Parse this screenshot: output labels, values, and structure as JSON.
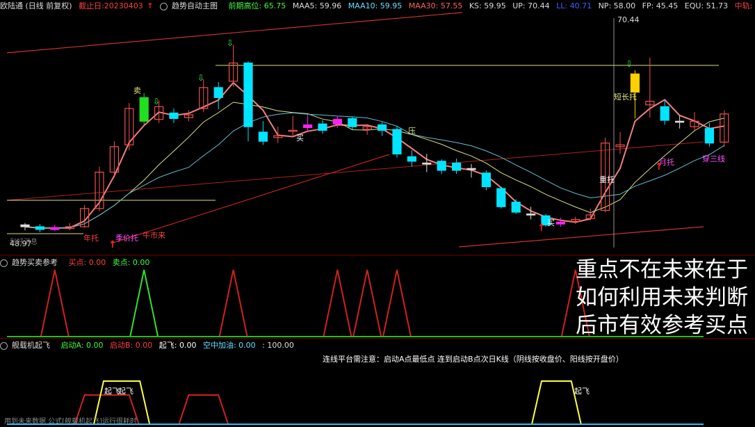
{
  "header_main": {
    "stock": "欧陆通 (日线 前复权)",
    "cutoff_label": "截止日:20230403",
    "arrow": "↑",
    "indicator": "趋势自动主图",
    "prev_high": "前期高位: 65.75",
    "maa5": "MAA5: 59.96",
    "maa10": "MAA10: 59.95",
    "maa30": "MAA30: 57.55",
    "ks": "KS: 59.95",
    "up": "UP: 70.44",
    "ll": "LL: 40.71",
    "np": "NP: 58.00",
    "fp": "FP: 45.45",
    "equ": "EQU: 51.73",
    "mid": "中轨: 58.",
    "diamond": "◇"
  },
  "header_sub1": {
    "name": "趋势买卖参考",
    "buy": "买点: 0.00",
    "sell": "卖点: 0.00"
  },
  "header_sub2": {
    "name": "舰载机起飞",
    "a": "启动A: 0.00",
    "b": "启动B: 0.00",
    "takeoff": "起飞: 0.00",
    "refuel": "空中加油: 0.00",
    "hundred": ": 100.00"
  },
  "note_line": "连线平台需注意：启动A点最低点 连到启动B点次日K线（阴线按收盘价、阳线按开盘价）",
  "overlay": [
    "重点不在未来在于",
    "如何利用未来判断",
    "后市有效参考买点"
  ],
  "footer_text": "用到未来数据 公式[舰载机起飞]运行很耗时",
  "colors": {
    "up": "#f05050",
    "down": "#00e5ff",
    "ma_pink": "#f08080",
    "ma_yellow": "#e0e080",
    "ma_cyan": "#60c0d0",
    "trend_red": "#c02020"
  },
  "chart_data": [
    {
      "type": "candlestick",
      "title": "趋势自动主图",
      "ylim": [
        45,
        71
      ],
      "annotations": {
        "high_label": "70.44",
        "low_label": "48.97",
        "labels": [
          "卖",
          "买",
          "压",
          "买",
          "重托",
          "短长托",
          "月托",
          "穿三线",
          "年托",
          "季价托",
          "牛市来",
          "利好消息"
        ]
      },
      "candles": [
        {
          "o": 47.8,
          "c": 47.6,
          "h": 48.0,
          "l": 47.2,
          "t": "flat"
        },
        {
          "o": 47.6,
          "c": 47.3,
          "h": 47.9,
          "l": 47.0,
          "t": "down"
        },
        {
          "o": 47.3,
          "c": 47.5,
          "h": 47.8,
          "l": 47.1,
          "t": "magenta"
        },
        {
          "o": 47.4,
          "c": 47.6,
          "h": 48.0,
          "l": 47.2,
          "t": "up"
        },
        {
          "o": 47.6,
          "c": 49.6,
          "h": 50.0,
          "l": 47.5,
          "t": "up"
        },
        {
          "o": 49.6,
          "c": 53.6,
          "h": 54.2,
          "l": 49.3,
          "t": "up"
        },
        {
          "o": 53.6,
          "c": 56.4,
          "h": 57.0,
          "l": 53.2,
          "t": "up"
        },
        {
          "o": 56.6,
          "c": 60.6,
          "h": 61.2,
          "l": 56.0,
          "t": "up"
        },
        {
          "o": 61.8,
          "c": 59.2,
          "h": 62.3,
          "l": 58.8,
          "t": "green"
        },
        {
          "o": 59.4,
          "c": 60.8,
          "h": 61.5,
          "l": 59.0,
          "t": "up"
        },
        {
          "o": 60.1,
          "c": 59.5,
          "h": 60.6,
          "l": 59.0,
          "t": "down"
        },
        {
          "o": 59.6,
          "c": 59.9,
          "h": 60.4,
          "l": 59.2,
          "t": "up"
        },
        {
          "o": 60.6,
          "c": 62.9,
          "h": 63.8,
          "l": 60.2,
          "t": "up"
        },
        {
          "o": 62.9,
          "c": 61.8,
          "h": 63.5,
          "l": 60.5,
          "t": "down"
        },
        {
          "o": 63.6,
          "c": 65.6,
          "h": 67.6,
          "l": 63.0,
          "t": "up"
        },
        {
          "o": 65.6,
          "c": 58.6,
          "h": 65.8,
          "l": 57.0,
          "t": "down"
        },
        {
          "o": 58.0,
          "c": 57.0,
          "h": 59.2,
          "l": 56.6,
          "t": "down"
        },
        {
          "o": 57.6,
          "c": 57.4,
          "h": 58.6,
          "l": 56.8,
          "t": "up"
        },
        {
          "o": 58.2,
          "c": 58.1,
          "h": 59.8,
          "l": 57.6,
          "t": "up"
        },
        {
          "o": 58.5,
          "c": 58.8,
          "h": 59.9,
          "l": 58.0,
          "t": "magenta"
        },
        {
          "o": 58.9,
          "c": 58.2,
          "h": 59.3,
          "l": 57.8,
          "t": "down"
        },
        {
          "o": 58.9,
          "c": 59.4,
          "h": 59.8,
          "l": 58.5,
          "t": "magenta"
        },
        {
          "o": 59.5,
          "c": 58.6,
          "h": 59.7,
          "l": 58.3,
          "t": "down"
        },
        {
          "o": 58.6,
          "c": 58.3,
          "h": 58.9,
          "l": 57.7,
          "t": "up"
        },
        {
          "o": 58.8,
          "c": 58.2,
          "h": 59.1,
          "l": 57.6,
          "t": "down"
        },
        {
          "o": 58.3,
          "c": 55.6,
          "h": 58.6,
          "l": 55.2,
          "t": "down"
        },
        {
          "o": 55.3,
          "c": 54.8,
          "h": 56.0,
          "l": 54.2,
          "t": "down"
        },
        {
          "o": 54.6,
          "c": 54.6,
          "h": 55.6,
          "l": 53.6,
          "t": "flat"
        },
        {
          "o": 54.8,
          "c": 53.8,
          "h": 55.0,
          "l": 53.4,
          "t": "down"
        },
        {
          "o": 54.6,
          "c": 53.8,
          "h": 55.1,
          "l": 53.4,
          "t": "down"
        },
        {
          "o": 54.0,
          "c": 53.9,
          "h": 54.5,
          "l": 53.0,
          "t": "flat"
        },
        {
          "o": 53.5,
          "c": 52.0,
          "h": 53.8,
          "l": 51.6,
          "t": "down"
        },
        {
          "o": 51.8,
          "c": 49.8,
          "h": 52.0,
          "l": 49.6,
          "t": "down"
        },
        {
          "o": 50.3,
          "c": 49.2,
          "h": 50.6,
          "l": 49.0,
          "t": "down"
        },
        {
          "o": 49.0,
          "c": 49.0,
          "h": 49.8,
          "l": 48.4,
          "t": "flat"
        },
        {
          "o": 48.8,
          "c": 47.8,
          "h": 49.0,
          "l": 47.6,
          "t": "down"
        },
        {
          "o": 47.9,
          "c": 48.1,
          "h": 48.6,
          "l": 47.6,
          "t": "magenta"
        },
        {
          "o": 48.2,
          "c": 48.4,
          "h": 48.7,
          "l": 47.9,
          "t": "up"
        },
        {
          "o": 48.5,
          "c": 48.9,
          "h": 49.6,
          "l": 48.3,
          "t": "up"
        },
        {
          "o": 49.4,
          "c": 56.8,
          "h": 57.4,
          "l": 49.2,
          "t": "up"
        },
        {
          "o": 56.6,
          "c": 56.4,
          "h": 58.0,
          "l": 55.6,
          "t": "up"
        },
        {
          "o": 62.4,
          "c": 64.4,
          "h": 64.8,
          "l": 59.5,
          "t": "yellow"
        },
        {
          "o": 61.4,
          "c": 61.0,
          "h": 66.2,
          "l": 59.6,
          "t": "up"
        },
        {
          "o": 60.8,
          "c": 59.3,
          "h": 61.5,
          "l": 58.8,
          "t": "down"
        },
        {
          "o": 59.2,
          "c": 59.2,
          "h": 59.8,
          "l": 58.4,
          "t": "flat"
        },
        {
          "o": 58.6,
          "c": 59.2,
          "h": 60.2,
          "l": 58.2,
          "t": "up"
        },
        {
          "o": 58.4,
          "c": 56.8,
          "h": 59.0,
          "l": 56.4,
          "t": "down"
        },
        {
          "o": 56.9,
          "c": 60.0,
          "h": 60.4,
          "l": 56.4,
          "t": "up"
        }
      ]
    },
    {
      "type": "line",
      "title": "趋势买卖参考",
      "series": [
        {
          "name": "买点",
          "peaks_at": [
            2,
            14,
            25,
            37
          ]
        },
        {
          "name": "卖点",
          "peaks_at": [
            8
          ]
        }
      ],
      "extra_red_peaks": [
        21,
        23
      ]
    },
    {
      "type": "line",
      "title": "舰载机起飞",
      "series": [
        {
          "name": "起飞",
          "pulses": [
            [
              5,
              8
            ],
            [
              35,
              37
            ]
          ]
        },
        {
          "name": "启动A",
          "pulses": [
            [
              4,
              7
            ],
            [
              11,
              13
            ]
          ]
        }
      ],
      "annotations": [
        "起飞",
        "起飞",
        "起飞"
      ]
    }
  ]
}
